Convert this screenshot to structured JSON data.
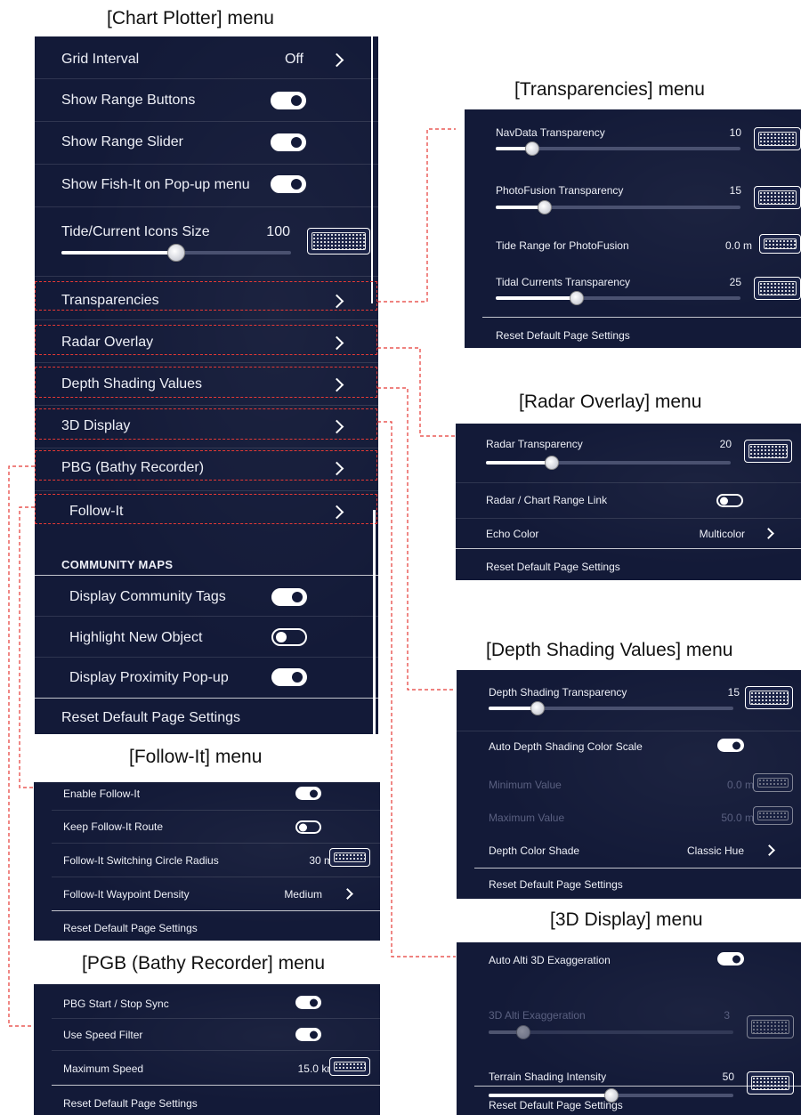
{
  "captions": {
    "chart_plotter": "[Chart Plotter] menu",
    "transparencies": "[Transparencies] menu",
    "radar_overlay": "[Radar Overlay] menu",
    "depth_shading": "[Depth Shading Values] menu",
    "follow_it": "[Follow-It] menu",
    "three_d": "[3D Display] menu",
    "pbg": "[PGB (Bathy Recorder] menu"
  },
  "chart_plotter": {
    "grid_interval": {
      "label": "Grid Interval",
      "value": "Off"
    },
    "show_range_buttons": {
      "label": "Show Range Buttons",
      "on": true
    },
    "show_range_slider": {
      "label": "Show Range Slider",
      "on": true
    },
    "show_fish_it": {
      "label": "Show Fish-It on Pop-up menu",
      "on": true
    },
    "tide_icons": {
      "label": "Tide/Current Icons Size",
      "value": "100",
      "level": 0.5
    },
    "transparencies": "Transparencies",
    "radar_overlay": "Radar Overlay",
    "depth_shading": "Depth Shading Values",
    "three_d": "3D Display",
    "pbg": "PBG (Bathy Recorder)",
    "follow_it": "Follow-It",
    "community_header": "COMMUNITY MAPS",
    "display_tags": {
      "label": "Display Community Tags",
      "on": true
    },
    "highlight_new": {
      "label": "Highlight New Object",
      "on": false
    },
    "display_proximity": {
      "label": "Display Proximity Pop-up",
      "on": true
    },
    "reset": "Reset Default Page Settings"
  },
  "transparencies": {
    "navdata": {
      "label": "NavData Transparency",
      "value": "10",
      "level": 0.1
    },
    "photofusion": {
      "label": "PhotoFusion Transparency",
      "value": "15",
      "level": 0.15
    },
    "tide_range": {
      "label": "Tide Range for PhotoFusion",
      "value": "0.0 m"
    },
    "tidal_currents": {
      "label": "Tidal Currents Transparency",
      "value": "25",
      "level": 0.25
    },
    "reset": "Reset Default Page Settings"
  },
  "radar_overlay": {
    "radar_transparency": {
      "label": "Radar Transparency",
      "value": "20",
      "level": 0.2
    },
    "range_link": {
      "label": "Radar / Chart Range Link",
      "on": false
    },
    "echo_color": {
      "label": "Echo Color",
      "value": "Multicolor"
    },
    "reset": "Reset Default Page Settings"
  },
  "depth_shading": {
    "transparency": {
      "label": "Depth Shading Transparency",
      "value": "15",
      "level": 0.15
    },
    "auto_scale": {
      "label": "Auto Depth Shading Color Scale",
      "on": true
    },
    "minimum": {
      "label": "Minimum Value",
      "value": "0.0 m"
    },
    "maximum": {
      "label": "Maximum Value",
      "value": "50.0 m"
    },
    "color_shade": {
      "label": "Depth Color Shade",
      "value": "Classic Hue"
    },
    "reset": "Reset Default Page Settings"
  },
  "follow_it": {
    "enable": {
      "label": "Enable Follow-It",
      "on": true
    },
    "keep_route": {
      "label": "Keep Follow-It Route",
      "on": false
    },
    "radius": {
      "label": "Follow-It Switching Circle Radius",
      "value": "30 m"
    },
    "density": {
      "label": "Follow-It Waypoint Density",
      "value": "Medium"
    },
    "reset": "Reset Default Page Settings"
  },
  "three_d": {
    "auto_alti": {
      "label": "Auto Alti 3D Exaggeration",
      "on": true
    },
    "alti_exag": {
      "label": "3D Alti Exaggeration",
      "value": "3",
      "level": 0.12
    },
    "terrain": {
      "label": "Terrain Shading Intensity",
      "value": "50",
      "level": 0.5
    },
    "reset": "Reset Default Page Settings"
  },
  "pbg": {
    "start_stop": {
      "label": "PBG Start / Stop Sync",
      "on": true
    },
    "speed_filter": {
      "label": "Use Speed Filter",
      "on": true
    },
    "max_speed": {
      "label": "Maximum Speed",
      "value": "15.0 kn"
    },
    "reset": "Reset Default Page Settings"
  },
  "colors": {
    "panel_bg": "#131a38",
    "callout": "#e53935",
    "text": "#eef0f7"
  }
}
